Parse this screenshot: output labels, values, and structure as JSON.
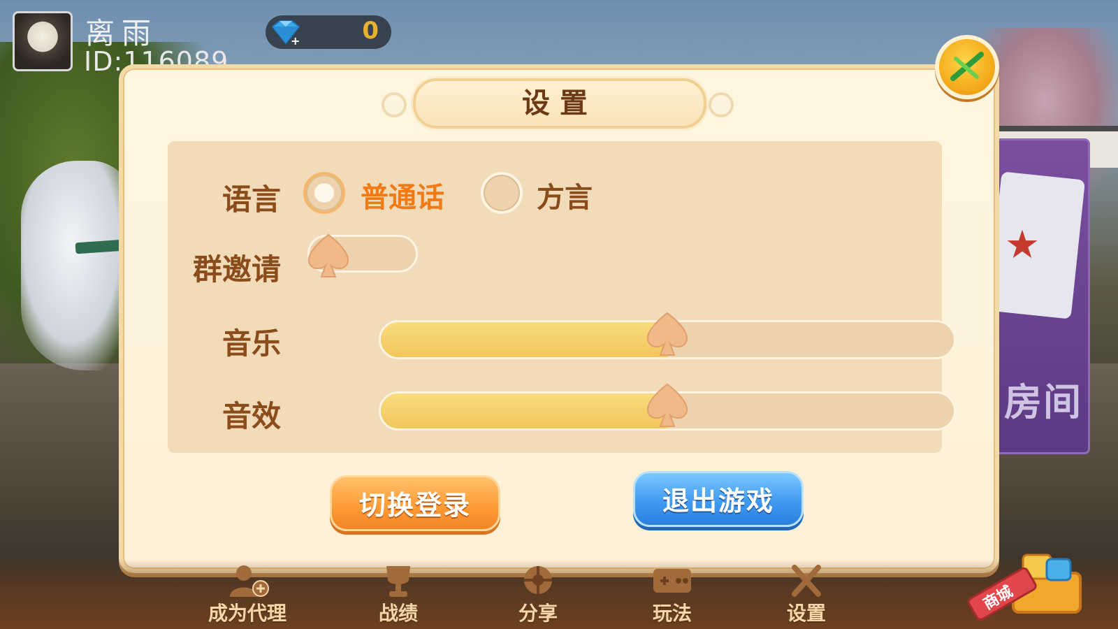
{
  "player": {
    "name": "离雨",
    "id_text": "ID:116089",
    "gem_count": "0"
  },
  "background": {
    "room_label": "房间"
  },
  "dialog": {
    "title": "设置",
    "language": {
      "label": "语言",
      "options": [
        {
          "label": "普通话",
          "selected": true
        },
        {
          "label": "方言",
          "selected": false
        }
      ]
    },
    "group_invite": {
      "label": "群邀请",
      "enabled": false
    },
    "music": {
      "label": "音乐",
      "level": 0.5
    },
    "sound_effect": {
      "label": "音效",
      "level": 0.5
    },
    "switch_login_label": "切换登录",
    "exit_game_label": "退出游戏"
  },
  "bottom_nav": [
    {
      "label": "成为代理",
      "icon": "agent-plus-icon"
    },
    {
      "label": "战绩",
      "icon": "trophy-icon"
    },
    {
      "label": "分享",
      "icon": "share-icon"
    },
    {
      "label": "玩法",
      "icon": "gamepad-icon"
    },
    {
      "label": "设置",
      "icon": "settings-icon"
    }
  ],
  "shop_label": "商城",
  "colors": {
    "selected_option": "#f07a16",
    "unselected_option": "#8a4c1a",
    "label": "#8a4c1a",
    "title": "#6b3a14",
    "spade": "#f0b98a"
  }
}
